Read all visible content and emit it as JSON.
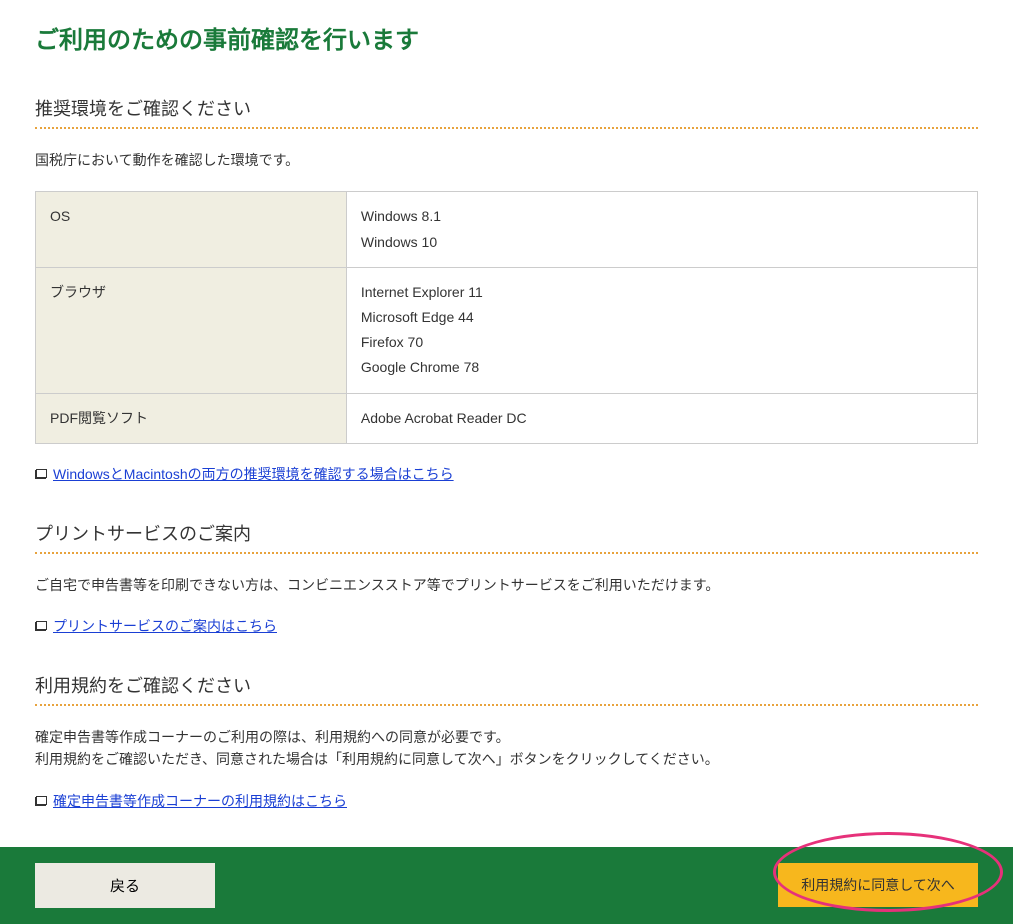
{
  "page_title": "ご利用のための事前確認を行います",
  "sections": {
    "env": {
      "heading": "推奨環境をご確認ください",
      "desc": "国税庁において動作を確認した環境です。",
      "rows": [
        {
          "label": "OS",
          "value": "Windows 8.1\nWindows 10"
        },
        {
          "label": "ブラウザ",
          "value": "Internet Explorer 11\nMicrosoft Edge 44\nFirefox 70\nGoogle Chrome 78"
        },
        {
          "label": "PDF閲覧ソフト",
          "value": "Adobe Acrobat Reader DC"
        }
      ],
      "link": "WindowsとMacintoshの両方の推奨環境を確認する場合はこちら"
    },
    "print": {
      "heading": "プリントサービスのご案内",
      "desc": "ご自宅で申告書等を印刷できない方は、コンビニエンスストア等でプリントサービスをご利用いただけます。",
      "link": "プリントサービスのご案内はこちら"
    },
    "terms": {
      "heading": "利用規約をご確認ください",
      "desc": "確定申告書等作成コーナーのご利用の際は、利用規約への同意が必要です。\n利用規約をご確認いただき、同意された場合は「利用規約に同意して次へ」ボタンをクリックしてください。",
      "link": "確定申告書等作成コーナーの利用規約はこちら"
    }
  },
  "footer": {
    "back": "戻る",
    "agree": "利用規約に同意して次へ"
  }
}
